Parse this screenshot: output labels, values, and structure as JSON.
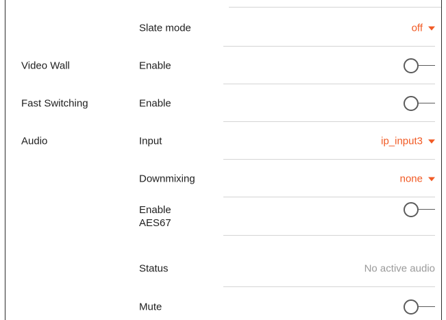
{
  "rows": [
    {
      "section": "",
      "label": "Slate mode",
      "control": "dropdown",
      "value": "off"
    },
    {
      "section": "Video Wall",
      "label": "Enable",
      "control": "toggle",
      "value": "off"
    },
    {
      "section": "Fast Switching",
      "label": "Enable",
      "control": "toggle",
      "value": "off"
    },
    {
      "section": "Audio",
      "label": "Input",
      "control": "dropdown",
      "value": "ip_input3"
    },
    {
      "section": "",
      "label": "Downmixing",
      "control": "dropdown",
      "value": "none"
    },
    {
      "section": "",
      "label": "Enable AES67",
      "control": "toggle",
      "value": "off"
    },
    {
      "section": "",
      "label": "Status",
      "control": "text",
      "value": "No active audio"
    },
    {
      "section": "",
      "label": "Mute",
      "control": "toggle",
      "value": "off"
    }
  ],
  "colors": {
    "accent": "#f15a24",
    "muted_text": "#9a9a9a",
    "divider": "#d4d4d4",
    "toggle_stroke": "#5a5a5a"
  },
  "icons": {
    "dropdown": "caret-down-icon",
    "toggle": "toggle-switch-icon"
  }
}
